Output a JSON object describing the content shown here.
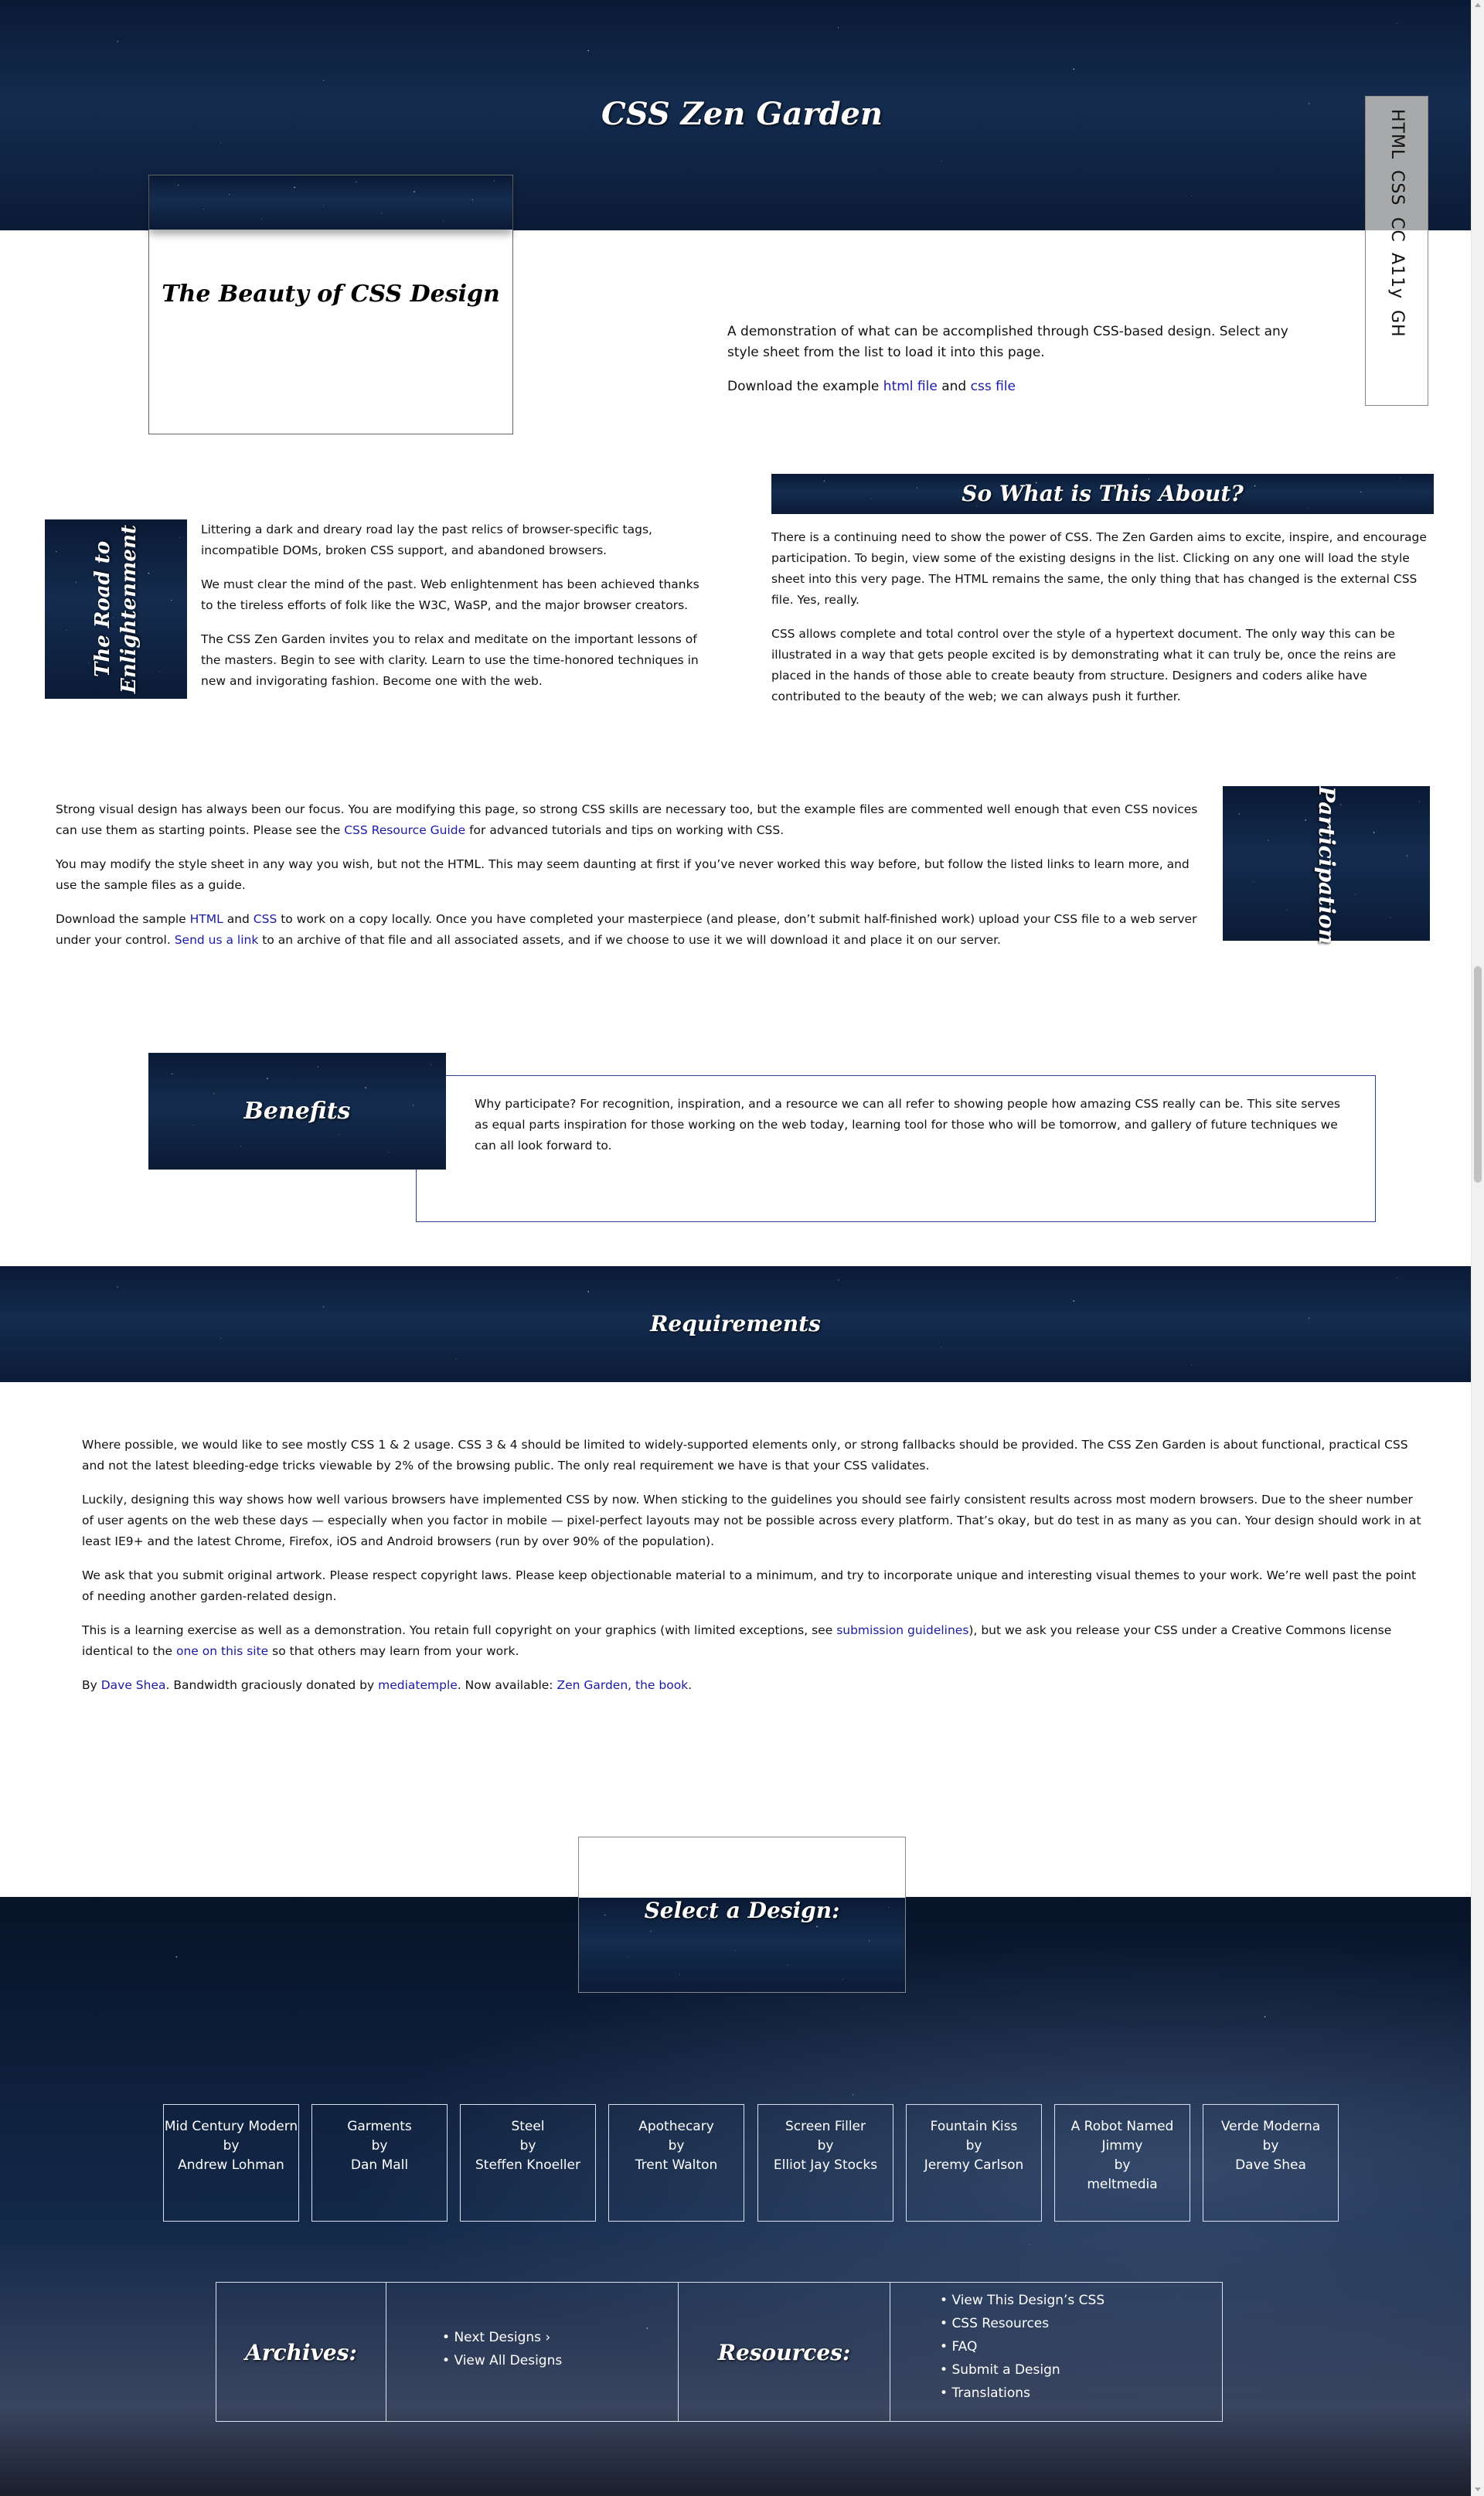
{
  "header": {
    "site_title": "CSS Zen Garden",
    "tagline": "The Beauty of CSS Design"
  },
  "side_nav": {
    "items": [
      "HTML",
      "CSS",
      "CC",
      "A11y",
      "GH"
    ]
  },
  "intro": {
    "summary": "A demonstration of what can be accomplished through CSS-based design. Select any style sheet from the list to load it into this page.",
    "download_prefix": "Download the example ",
    "html_file": "html file",
    "and": " and ",
    "css_file": "css file"
  },
  "preamble": {
    "title_line1": "The Road to",
    "title_line2": "Enlightenment",
    "p1": "Littering a dark and dreary road lay the past relics of browser-specific tags, incompatible DOMs, broken CSS support, and abandoned browsers.",
    "p2": "We must clear the mind of the past. Web enlightenment has been achieved thanks to the tireless efforts of folk like the W3C, WaSP, and the major browser creators.",
    "p3": "The CSS Zen Garden invites you to relax and meditate on the important lessons of the masters. Begin to see with clarity. Learn to use the time-honored techniques in new and invigorating fashion. Become one with the web."
  },
  "explanation": {
    "title": "So What is This About?",
    "p1": "There is a continuing need to show the power of CSS. The Zen Garden aims to excite, inspire, and encourage participation. To begin, view some of the existing designs in the list. Clicking on any one will load the style sheet into this very page. The HTML remains the same, the only thing that has changed is the external CSS file. Yes, really.",
    "p2": "CSS allows complete and total control over the style of a hypertext document. The only way this can be illustrated in a way that gets people excited is by demonstrating what it can truly be, once the reins are placed in the hands of those able to create beauty from structure. Designers and coders alike have contributed to the beauty of the web; we can always push it further."
  },
  "participation": {
    "title": "Participation",
    "p1_a": "Strong visual design has always been our focus. You are modifying this page, so strong CSS skills are necessary too, but the example files are commented well enough that even CSS novices can use them as starting points. Please see the ",
    "p1_link": "CSS Resource Guide",
    "p1_b": " for advanced tutorials and tips on working with CSS.",
    "p2": "You may modify the style sheet in any way you wish, but not the HTML. This may seem daunting at first if you’ve never worked this way before, but follow the listed links to learn more, and use the sample files as a guide.",
    "p3_a": "Download the sample ",
    "p3_html": "HTML",
    "p3_and": " and ",
    "p3_css": "CSS",
    "p3_b": " to work on a copy locally. Once you have completed your masterpiece (and please, don’t submit half-finished work) upload your CSS file to a web server under your control. ",
    "p3_link": "Send us a link",
    "p3_c": " to an archive of that file and all associated assets, and if we choose to use it we will download it and place it on our server."
  },
  "benefits": {
    "title": "Benefits",
    "text": "Why participate? For recognition, inspiration, and a resource we can all refer to showing people how amazing CSS really can be. This site serves as equal parts inspiration for those working on the web today, learning tool for those who will be tomorrow, and gallery of future techniques we can all look forward to."
  },
  "requirements": {
    "title": "Requirements",
    "p1": "Where possible, we would like to see mostly CSS 1 & 2 usage. CSS 3 & 4 should be limited to widely-supported elements only, or strong fallbacks should be provided. The CSS Zen Garden is about functional, practical CSS and not the latest bleeding-edge tricks viewable by 2% of the browsing public. The only real requirement we have is that your CSS validates.",
    "p2": "Luckily, designing this way shows how well various browsers have implemented CSS by now. When sticking to the guidelines you should see fairly consistent results across most modern browsers. Due to the sheer number of user agents on the web these days — especially when you factor in mobile — pixel-perfect layouts may not be possible across every platform. That’s okay, but do test in as many as you can. Your design should work in at least IE9+ and the latest Chrome, Firefox, iOS and Android browsers (run by over 90% of the population).",
    "p3": "We ask that you submit original artwork. Please respect copyright laws. Please keep objectionable material to a minimum, and try to incorporate unique and interesting visual themes to your work. We’re well past the point of needing another garden-related design.",
    "p4_a": "This is a learning exercise as well as a demonstration. You retain full copyright on your graphics (with limited exceptions, see ",
    "p4_link1": "submission guidelines",
    "p4_b": "), but we ask you release your CSS under a Creative Commons license identical to the ",
    "p4_link2": "one on this site",
    "p4_c": " so that others may learn from your work.",
    "p5_a": "By ",
    "p5_link1": "Dave Shea",
    "p5_b": ". Bandwidth graciously donated by ",
    "p5_link2": "mediatemple",
    "p5_c": ". Now available: ",
    "p5_link3": "Zen Garden, the book",
    "p5_d": "."
  },
  "select_design": {
    "title": "Select a Design:",
    "by": "by",
    "designs": [
      {
        "name": "Mid Century Modern",
        "author": "Andrew Lohman"
      },
      {
        "name": "Garments",
        "author": "Dan Mall"
      },
      {
        "name": "Steel",
        "author": "Steffen Knoeller"
      },
      {
        "name": "Apothecary",
        "author": "Trent Walton"
      },
      {
        "name": "Screen Filler",
        "author": "Elliot Jay Stocks"
      },
      {
        "name": "Fountain Kiss",
        "author": "Jeremy Carlson"
      },
      {
        "name": "A Robot Named Jimmy",
        "author": "meltmedia"
      },
      {
        "name": "Verde Moderna",
        "author": "Dave Shea"
      }
    ]
  },
  "archives": {
    "title": "Archives:",
    "next": "Next Designs ›",
    "all": "View All Designs"
  },
  "resources": {
    "title": "Resources:",
    "items": [
      "View This Design’s CSS",
      "CSS Resources",
      "FAQ",
      "Submit a Design",
      "Translations"
    ]
  },
  "colors": {
    "link": "#1a1aa6",
    "night_sky": "#06142b",
    "panel_border": "#2a3f8f"
  }
}
